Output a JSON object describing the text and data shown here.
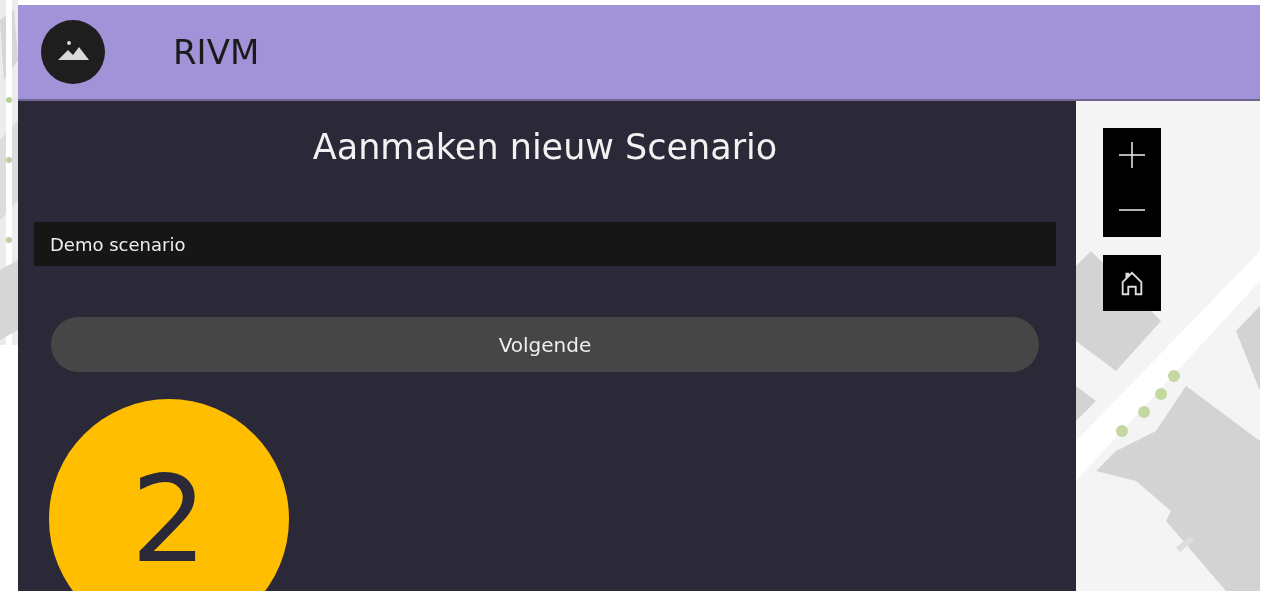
{
  "header": {
    "title": "RIVM"
  },
  "panel": {
    "title": "Aanmaken nieuw Scenario",
    "name_field": {
      "value": "Demo scenario"
    },
    "next_button": {
      "label": "Volgende"
    }
  },
  "step_badge": {
    "label": "2"
  }
}
